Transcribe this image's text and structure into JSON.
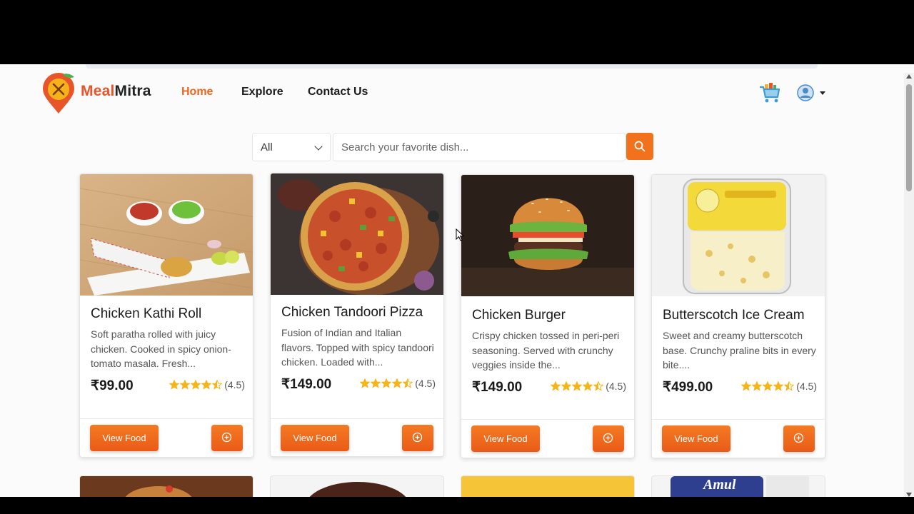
{
  "brand": {
    "name_part1": "Meal",
    "name_part2": "Mitra",
    "primary_color": "#f2711c"
  },
  "nav": {
    "links": [
      {
        "label": "Home",
        "active": true
      },
      {
        "label": "Explore",
        "active": false
      },
      {
        "label": "Contact Us",
        "active": false
      }
    ],
    "cart_icon": "shopping-cart-icon",
    "user_icon": "user-avatar-icon"
  },
  "search": {
    "category_selected": "All",
    "placeholder": "Search your favorite dish..."
  },
  "foods": [
    {
      "title": "Chicken Kathi Roll",
      "description": "Soft paratha rolled with juicy chicken. Cooked in spicy onion-tomato masala. Fresh...",
      "price": "₹99.00",
      "rating": 4.5,
      "rating_label": "(4.5)",
      "view_label": "View Food"
    },
    {
      "title": "Chicken Tandoori Pizza",
      "description": "Fusion of Indian and Italian flavors. Topped with spicy tandoori chicken. Loaded with...",
      "price": "₹149.00",
      "rating": 4.5,
      "rating_label": "(4.5)",
      "view_label": "View Food"
    },
    {
      "title": "Chicken Burger",
      "description": "Crispy chicken tossed in peri-peri seasoning. Served with crunchy veggies inside the...",
      "price": "₹149.00",
      "rating": 4.5,
      "rating_label": "(4.5)",
      "view_label": "View Food"
    },
    {
      "title": "Butterscotch Ice Cream",
      "description": "Sweet and creamy butterscotch base. Crunchy praline bits in every bite....",
      "price": "₹499.00",
      "rating": 4.5,
      "rating_label": "(4.5)",
      "view_label": "View Food"
    }
  ],
  "partial_row": {
    "amul_label": "Amul"
  }
}
